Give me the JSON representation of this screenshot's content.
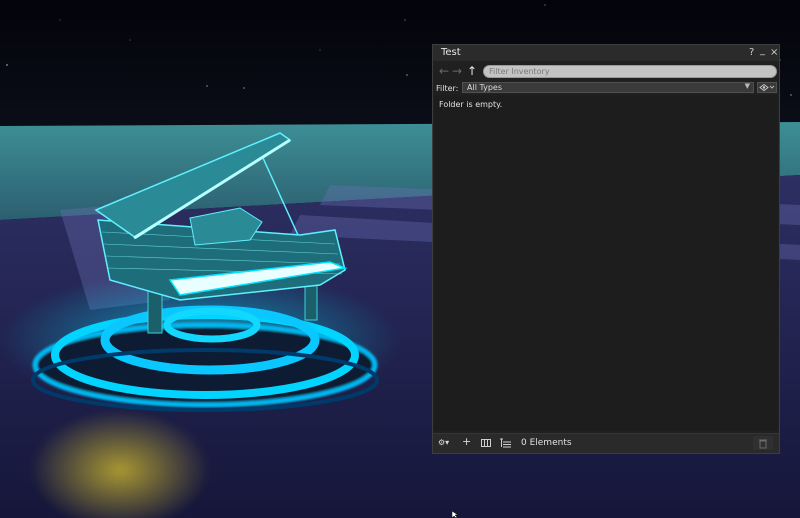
{
  "window": {
    "title": "Test"
  },
  "titlebar_buttons": {
    "help": "?",
    "minimize": "_",
    "close": "×"
  },
  "nav": {
    "back": "←",
    "forward": "→",
    "up": "↑"
  },
  "search": {
    "placeholder": "Filter Inventory"
  },
  "filter": {
    "label": "Filter:",
    "value": "All Types"
  },
  "content": {
    "empty_message": "Folder is empty."
  },
  "bottom_bar": {
    "gear": "⚙▾",
    "add": "+",
    "count": "0 Elements"
  },
  "colors": {
    "panel_bg": "#202020",
    "neon": "#00c8ff",
    "water": "#3a7f86"
  }
}
